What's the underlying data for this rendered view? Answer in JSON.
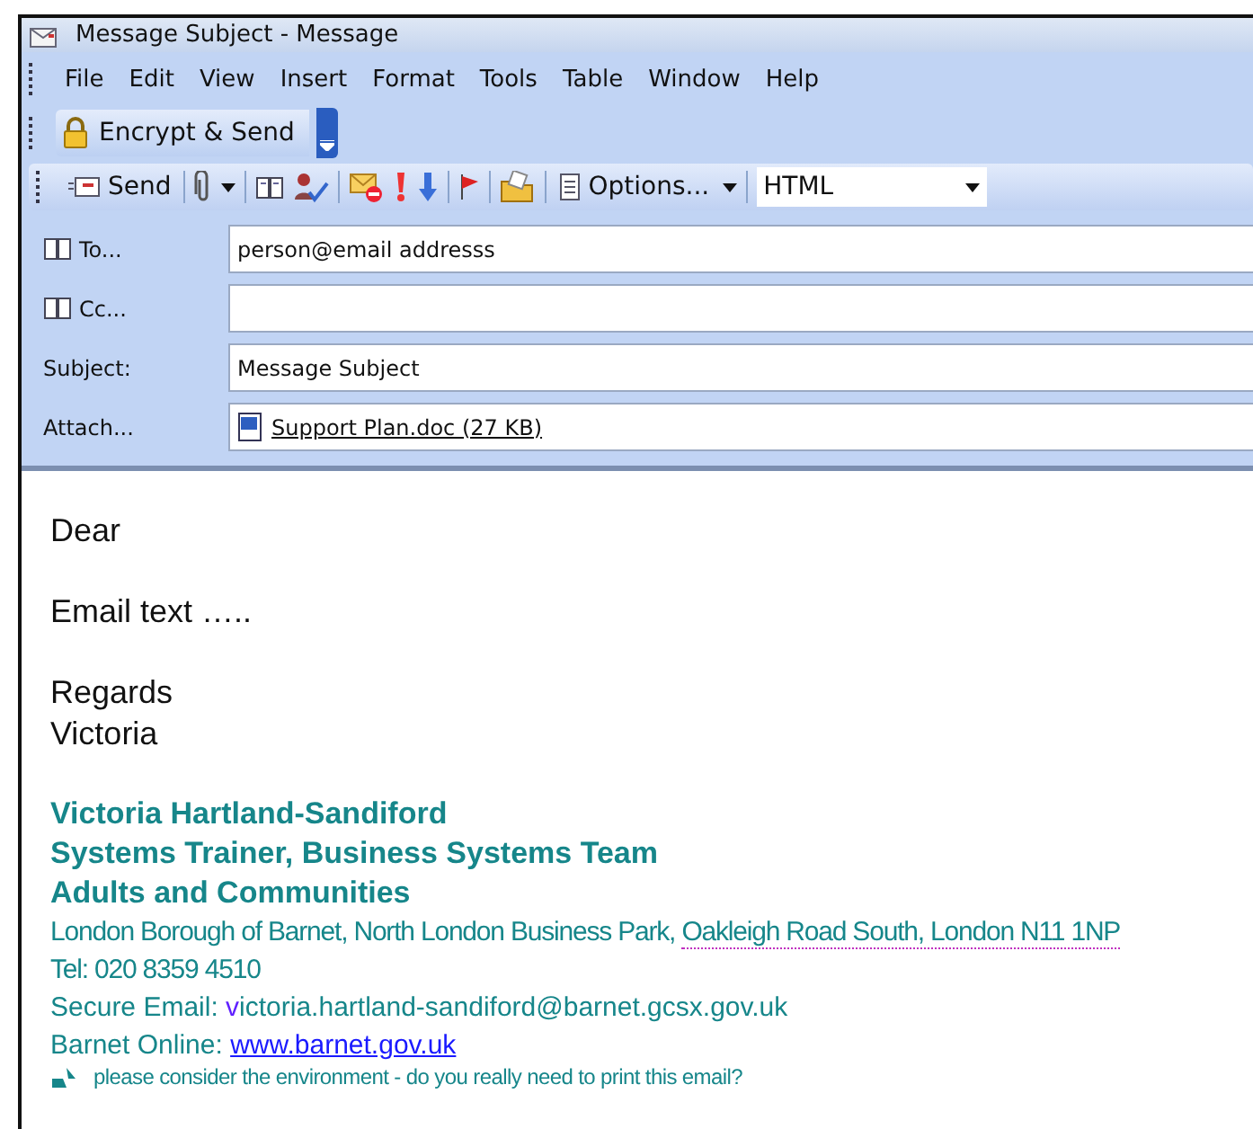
{
  "window": {
    "title": "Message Subject  - Message"
  },
  "menu": [
    "File",
    "Edit",
    "View",
    "Insert",
    "Format",
    "Tools",
    "Table",
    "Window",
    "Help"
  ],
  "encrypt_toolbar": {
    "button": "Encrypt & Send"
  },
  "toolbar": {
    "send": "Send",
    "options": "Options...",
    "format": "HTML"
  },
  "fields": [
    {
      "kind": "address",
      "label": "To...",
      "value": "person@email addresss"
    },
    {
      "kind": "address",
      "label": "Cc..."
    },
    {
      "kind": "text",
      "label": "Subject:",
      "value": "Message Subject"
    },
    {
      "kind": "attachment",
      "label": "Attach...",
      "value": "Support Plan.doc (27 KB)"
    }
  ],
  "body": {
    "paragraphs": [
      [
        "Dear"
      ],
      [
        "Email text ….."
      ],
      [
        "Regards",
        "Victoria"
      ]
    ],
    "signature": {
      "heading": [
        "Victoria Hartland-Sandiford",
        "Systems Trainer, Business Systems Team",
        "Adults and Communities"
      ],
      "address": "London Borough of Barnet, North London Business Park, ",
      "address_link": "Oakleigh Road South, London N11 1NP",
      "tel": "Tel: 020 8359 4510",
      "email_label": "Secure Email: ",
      "email": "victoria.hartland-sandiford@barnet.gcsx.gov.uk",
      "web_label": "Barnet Online: ",
      "web": "www.barnet.gov.uk",
      "footer": "please consider the environment - do you really need to print this email?"
    }
  }
}
